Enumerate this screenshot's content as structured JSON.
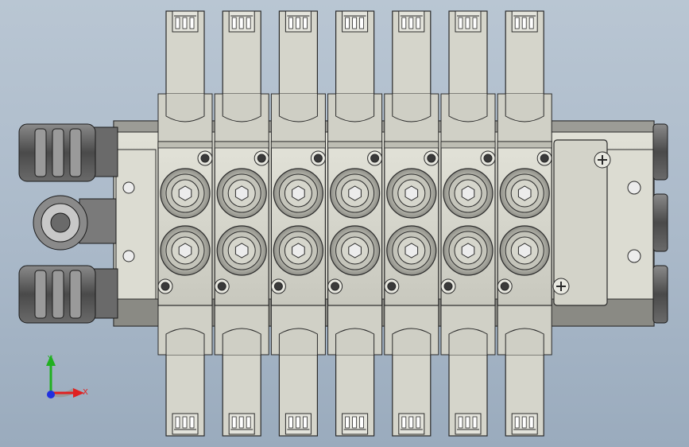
{
  "viewport": {
    "background_top": "#b9c6d3",
    "background_bottom": "#9aabbd"
  },
  "model": {
    "valve_count": 7,
    "body_color": "#d5d5cb",
    "edge_color": "#2a2a2a",
    "shadow_color": "#7a7a74",
    "dark_fitting_color": "#5a5a5a"
  },
  "triad": {
    "x_label": "X",
    "y_label": "Y",
    "x_color": "#e02020",
    "y_color": "#20b020",
    "z_color": "#2030e0"
  }
}
